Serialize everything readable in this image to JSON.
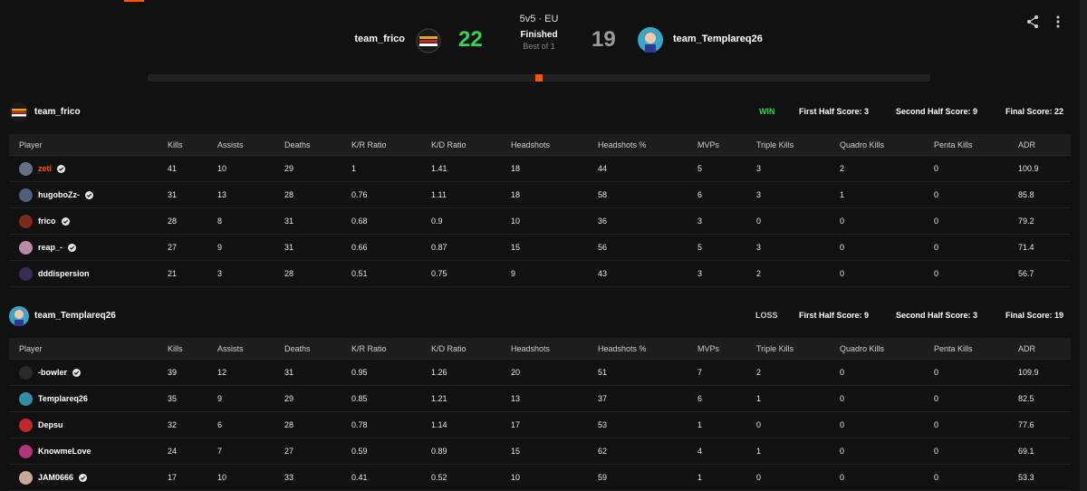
{
  "header": {
    "mode": "5v5 · EU",
    "status": "Finished",
    "best_of": "Best of 1",
    "team_left": {
      "name": "team_frico",
      "score": "22"
    },
    "team_right": {
      "name": "team_Templareq26",
      "score": "19"
    },
    "icons": {
      "share": "share-icon",
      "menu": "more-vertical-icon"
    },
    "colors": {
      "accent": "#ff5500",
      "win_score": "#32d35a",
      "loss_score": "#9a9a9a"
    }
  },
  "columns": [
    "Player",
    "Kills",
    "Assists",
    "Deaths",
    "K/R Ratio",
    "K/D Ratio",
    "Headshots",
    "Headshots %",
    "MVPs",
    "Triple Kills",
    "Quadro Kills",
    "Penta Kills",
    "ADR"
  ],
  "teams": [
    {
      "name": "team_frico",
      "result": "WIN",
      "result_color": "#32d35a",
      "first_half": "First Half Score: 3",
      "second_half": "Second Half Score: 9",
      "final": "Final Score: 22",
      "players": [
        {
          "name": "zeti",
          "verified": true,
          "highlight": true,
          "avatar_color": "#6a6f88",
          "stats": [
            "41",
            "10",
            "29",
            "1",
            "1.41",
            "18",
            "44",
            "5",
            "3",
            "2",
            "0",
            "100.9"
          ]
        },
        {
          "name": "hugoboZz-",
          "verified": true,
          "highlight": false,
          "avatar_color": "#4f5f7a",
          "stats": [
            "31",
            "13",
            "28",
            "0.76",
            "1.11",
            "18",
            "58",
            "6",
            "3",
            "1",
            "0",
            "85.8"
          ]
        },
        {
          "name": "frico",
          "verified": true,
          "highlight": false,
          "avatar_color": "#7a2b1a",
          "stats": [
            "28",
            "8",
            "31",
            "0.68",
            "0.9",
            "10",
            "36",
            "3",
            "0",
            "0",
            "0",
            "79.2"
          ]
        },
        {
          "name": "reap_-",
          "verified": true,
          "highlight": false,
          "avatar_color": "#b88aa8",
          "stats": [
            "27",
            "9",
            "31",
            "0.66",
            "0.87",
            "15",
            "56",
            "5",
            "3",
            "0",
            "0",
            "71.4"
          ]
        },
        {
          "name": "dddispersion",
          "verified": false,
          "highlight": false,
          "avatar_color": "#3b2b52",
          "stats": [
            "21",
            "3",
            "28",
            "0.51",
            "0.75",
            "9",
            "43",
            "3",
            "2",
            "0",
            "0",
            "56.7"
          ]
        }
      ]
    },
    {
      "name": "team_Templareq26",
      "result": "LOSS",
      "result_color": "#cfcfcf",
      "first_half": "First Half Score: 9",
      "second_half": "Second Half Score: 3",
      "final": "Final Score: 19",
      "players": [
        {
          "name": "-bowler",
          "verified": true,
          "highlight": false,
          "avatar_color": "#2a2a2a",
          "stats": [
            "39",
            "12",
            "31",
            "0.95",
            "1.26",
            "20",
            "51",
            "7",
            "2",
            "0",
            "0",
            "109.9"
          ]
        },
        {
          "name": "Templareq26",
          "verified": false,
          "highlight": false,
          "avatar_color": "#2f8fa8",
          "stats": [
            "35",
            "9",
            "29",
            "0.85",
            "1.21",
            "13",
            "37",
            "6",
            "1",
            "0",
            "0",
            "82.5"
          ]
        },
        {
          "name": "Depsu",
          "verified": false,
          "highlight": false,
          "avatar_color": "#c0282d",
          "stats": [
            "32",
            "6",
            "28",
            "0.78",
            "1.14",
            "17",
            "53",
            "1",
            "0",
            "0",
            "0",
            "77.6"
          ]
        },
        {
          "name": "KnowmeLove",
          "verified": false,
          "highlight": false,
          "avatar_color": "#b0357a",
          "stats": [
            "24",
            "7",
            "27",
            "0.59",
            "0.89",
            "15",
            "62",
            "4",
            "1",
            "0",
            "0",
            "69.1"
          ]
        },
        {
          "name": "JAM0666",
          "verified": true,
          "highlight": false,
          "avatar_color": "#c9a896",
          "stats": [
            "17",
            "10",
            "33",
            "0.41",
            "0.52",
            "10",
            "59",
            "1",
            "0",
            "0",
            "0",
            "53.3"
          ]
        }
      ]
    }
  ]
}
